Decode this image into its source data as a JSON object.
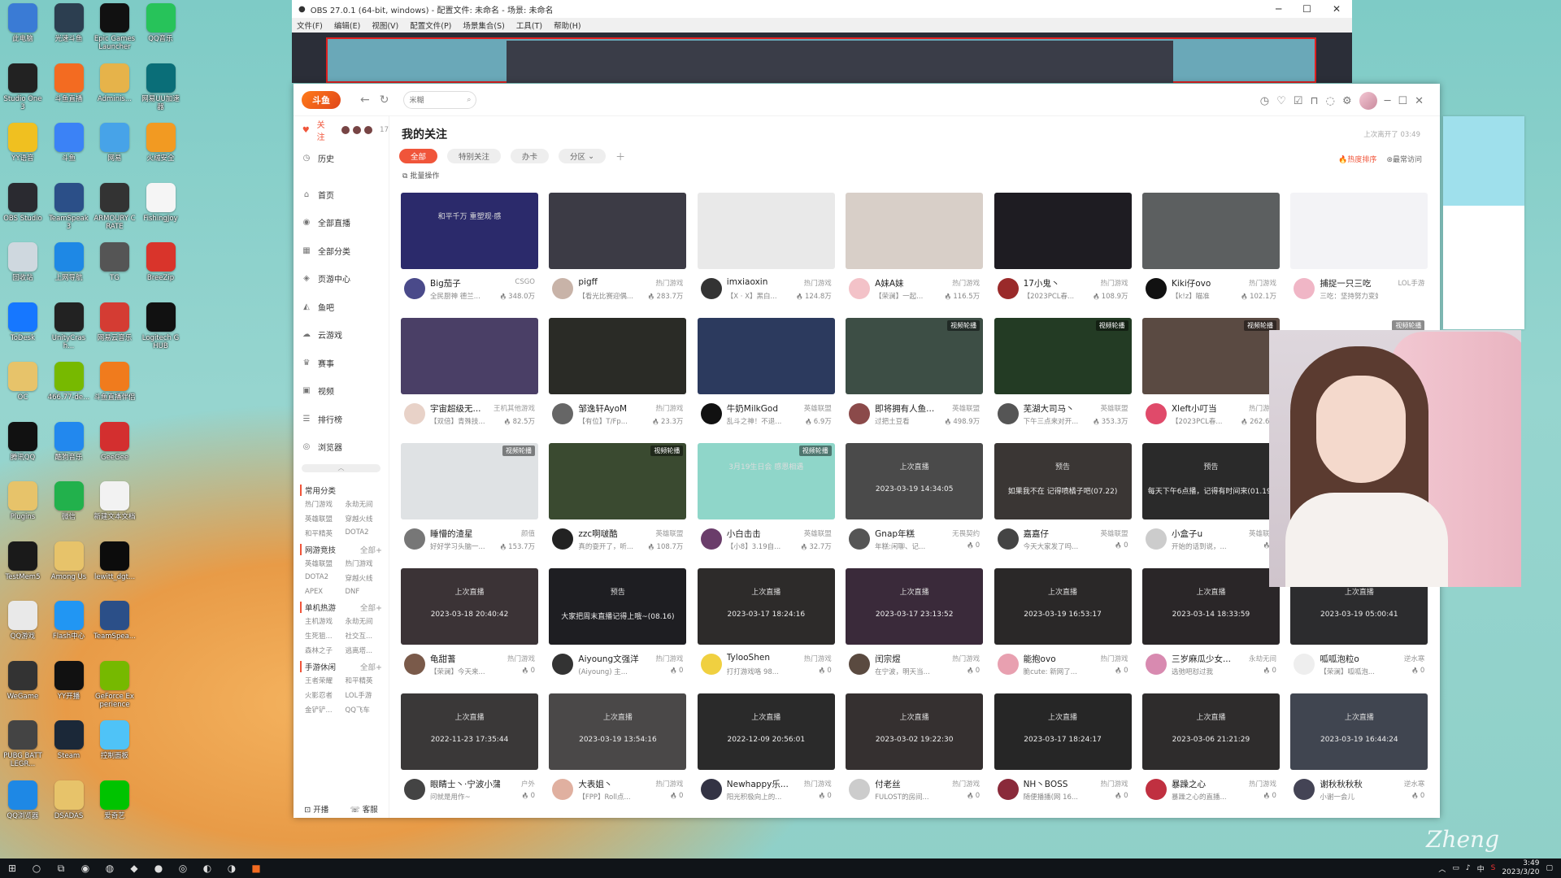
{
  "desktop": [
    {
      "label": "此电脑",
      "color": "#3a7bd5"
    },
    {
      "label": "光速斗鱼",
      "color": "#2c3e50"
    },
    {
      "label": "Epic Games Launcher",
      "color": "#111"
    },
    {
      "label": "QQ音乐",
      "color": "#27c35a"
    },
    {
      "label": "Studio One 3",
      "color": "#222"
    },
    {
      "label": "斗鱼直播",
      "color": "#f36b21"
    },
    {
      "label": "Adminis...",
      "color": "#e6b34a"
    },
    {
      "label": "网易UU加速器",
      "color": "#0a6e78"
    },
    {
      "label": "YY语音",
      "color": "#f0c020"
    },
    {
      "label": "斗鱼",
      "color": "#3b82f6"
    },
    {
      "label": "网易",
      "color": "#47a3e8"
    },
    {
      "label": "火绒安全",
      "color": "#f29a22"
    },
    {
      "label": "OBS Studio",
      "color": "#2a2a30"
    },
    {
      "label": "TeamSpeak 3",
      "color": "#2b4f88"
    },
    {
      "label": "ARMOURY CRATE",
      "color": "#333"
    },
    {
      "label": "FishingJoy",
      "color": "#f5f5f5"
    },
    {
      "label": "回收站",
      "color": "#cfd8df"
    },
    {
      "label": "上网导航",
      "color": "#1e88e5"
    },
    {
      "label": "TG",
      "color": "#555"
    },
    {
      "label": "BreeZip",
      "color": "#d9342b"
    },
    {
      "label": "ToDesk",
      "color": "#1677ff"
    },
    {
      "label": "UnityCrash...",
      "color": "#222"
    },
    {
      "label": "网易云音乐",
      "color": "#d43c33"
    },
    {
      "label": "Logitech G HUB",
      "color": "#111"
    },
    {
      "label": "OC",
      "color": "#e7c36a"
    },
    {
      "label": "466.77-de...",
      "color": "#77b900"
    },
    {
      "label": "斗鱼直播伴侣",
      "color": "#f07b1d"
    },
    {
      "label": "",
      "color": "transparent"
    },
    {
      "label": "腾讯QQ",
      "color": "#111"
    },
    {
      "label": "酷狗音乐",
      "color": "#2288ee"
    },
    {
      "label": "GeeGee",
      "color": "#d32f2f"
    },
    {
      "label": "",
      "color": "transparent"
    },
    {
      "label": "Plugins",
      "color": "#e7c36a"
    },
    {
      "label": "微信",
      "color": "#22b14c"
    },
    {
      "label": "新建文本文档",
      "color": "#f2f2f2"
    },
    {
      "label": "",
      "color": "transparent"
    },
    {
      "label": "TestMem5",
      "color": "#1a1a1a"
    },
    {
      "label": "Among Us",
      "color": "#e7c36a"
    },
    {
      "label": "lewitt_dgt...",
      "color": "#0c0c0c"
    },
    {
      "label": "",
      "color": "transparent"
    },
    {
      "label": "QQ游戏",
      "color": "#e9e9e9"
    },
    {
      "label": "Flash中心",
      "color": "#2196f3"
    },
    {
      "label": "TeamSpea...",
      "color": "#2b4f88"
    },
    {
      "label": "",
      "color": "transparent"
    },
    {
      "label": "WeGame",
      "color": "#333"
    },
    {
      "label": "YY开播",
      "color": "#111"
    },
    {
      "label": "GeForce Experience",
      "color": "#76b900"
    },
    {
      "label": "",
      "color": "transparent"
    },
    {
      "label": "PUBG BATTLEGR...",
      "color": "#444"
    },
    {
      "label": "Steam",
      "color": "#1b2838"
    },
    {
      "label": "控制面板",
      "color": "#4fc3f7"
    },
    {
      "label": "",
      "color": "transparent"
    },
    {
      "label": "QQ浏览器",
      "color": "#1e88e5"
    },
    {
      "label": "DSADAS",
      "color": "#e7c36a"
    },
    {
      "label": "爱奇艺",
      "color": "#00c300"
    },
    {
      "label": "",
      "color": "transparent"
    }
  ],
  "obs": {
    "title": "OBS 27.0.1 (64-bit, windows) - 配置文件: 未命名 - 场景: 未命名",
    "menu": [
      "文件(F)",
      "编辑(E)",
      "视图(V)",
      "配置文件(P)",
      "场景集合(S)",
      "工具(T)",
      "帮助(H)"
    ]
  },
  "app": {
    "logo": "斗鱼",
    "search_placeholder": "米糊",
    "side": {
      "follow": "关注",
      "follow_count": "17",
      "history": "历史",
      "items": [
        "首页",
        "全部直播",
        "全部分类",
        "页游中心",
        "鱼吧",
        "云游戏",
        "赛事",
        "视频",
        "排行榜",
        "浏览器"
      ],
      "sections": [
        {
          "title": "常用分类",
          "more": "",
          "items": [
            "热门游戏",
            "永劫无间",
            "英雄联盟",
            "穿越火线",
            "和平精英",
            "DOTA2"
          ]
        },
        {
          "title": "网游竞技",
          "more": "全部+",
          "items": [
            "英雄联盟",
            "热门游戏",
            "DOTA2",
            "穿越火线",
            "APEX",
            "DNF"
          ]
        },
        {
          "title": "单机热游",
          "more": "全部+",
          "items": [
            "主机游戏",
            "永劫无间",
            "生死狙...",
            "社交互...",
            "森林之子",
            "逃离塔..."
          ]
        },
        {
          "title": "手游休闲",
          "more": "全部+",
          "items": [
            "王者荣耀",
            "和平精英",
            "火影忍者",
            "LOL手游",
            "金铲铲...",
            "QQ飞车"
          ]
        }
      ],
      "bottom_left": "开播",
      "bottom_right": "客服"
    },
    "title": "我的关注",
    "last_visit": "上次离开了 03:49",
    "tabs": [
      "全部",
      "特别关注",
      "办卡",
      "分区"
    ],
    "sort_hot": "热度排序",
    "sort_recent": "最常访问",
    "batch": "批量操作",
    "cards": [
      {
        "name": "Big茄子",
        "cat": "CSGO",
        "desc": "全民厨神 德兰...",
        "heat": "348.0万",
        "thumb": "#2b2a6b",
        "tag": "",
        "ov": "和平千万 重塑观·感",
        "dt": "",
        "av": "#4a4a8a"
      },
      {
        "name": "pigff",
        "cat": "热门游戏",
        "desc": "【看光比赛迎偶...",
        "heat": "283.7万",
        "thumb": "#3c3b45",
        "tag": "",
        "ov": "",
        "dt": "",
        "av": "#c8b3a8"
      },
      {
        "name": "imxiaoxin",
        "cat": "热门游戏",
        "desc": "【X · X】黑白...",
        "heat": "124.8万",
        "thumb": "#e9e9e9",
        "tag": "",
        "ov": "",
        "dt": "",
        "av": "#333"
      },
      {
        "name": "A妹A妹",
        "cat": "热门游戏",
        "desc": "【荣澜】一起...",
        "heat": "116.5万",
        "thumb": "#d8cfc8",
        "tag": "",
        "ov": "",
        "dt": "",
        "av": "#f3c2c8"
      },
      {
        "name": "17小鬼丶",
        "cat": "热门游戏",
        "desc": "【2023PCL春...",
        "heat": "108.9万",
        "thumb": "#1e1c22",
        "tag": "",
        "ov": "",
        "dt": "",
        "av": "#9a2a2a"
      },
      {
        "name": "Kiki仔ovo",
        "cat": "热门游戏",
        "desc": "【k!z】瞄准",
        "heat": "102.1万",
        "thumb": "#5c5f60",
        "tag": "",
        "ov": "",
        "dt": "",
        "av": "#111"
      },
      {
        "name": "捕捉一只三吃",
        "cat": "LOL手游",
        "desc": "三吃：坚持努力变好！",
        "heat": "",
        "thumb": "#f3f3f6",
        "tag": "",
        "ov": "",
        "dt": "",
        "av": "#f0b6c6"
      },
      {
        "name": "宇宙超级无...",
        "cat": "王机其他游戏",
        "desc": "【双倍】青殊技...",
        "heat": "82.5万",
        "thumb": "#4a3f66",
        "tag": "",
        "ov": "",
        "dt": "",
        "av": "#e8d2c8"
      },
      {
        "name": "邹逸轩AyoM",
        "cat": "热门游戏",
        "desc": "【有位】T/Fp...",
        "heat": "23.3万",
        "thumb": "#2a2b26",
        "tag": "",
        "ov": "",
        "dt": "",
        "av": "#666"
      },
      {
        "name": "牛奶MilkGod",
        "cat": "英雄联盟",
        "desc": "乱斗之神！不退...",
        "heat": "6.9万",
        "thumb": "#2c3a5e",
        "tag": "",
        "ov": "",
        "dt": "",
        "av": "#111"
      },
      {
        "name": "即将拥有人鱼...",
        "cat": "英雄联盟",
        "desc": "过把土豆看",
        "heat": "498.9万",
        "thumb": "#3d4e45",
        "tag": "视频轮播",
        "ov": "",
        "dt": "",
        "av": "#8b4a4a"
      },
      {
        "name": "芜湖大司马丶",
        "cat": "英雄联盟",
        "desc": "下午三点来对开...",
        "heat": "353.3万",
        "thumb": "#233b24",
        "tag": "视频轮播",
        "ov": "",
        "dt": "",
        "av": "#555"
      },
      {
        "name": "Xleft小叮当",
        "cat": "热门游戏",
        "desc": "【2023PCL春...",
        "heat": "262.6万",
        "thumb": "#5a4a42",
        "tag": "视频轮播",
        "ov": "",
        "dt": "",
        "av": "#e04a6a"
      },
      {
        "name": "",
        "cat": "",
        "desc": "",
        "heat": "",
        "thumb": "#fff",
        "tag": "视频轮播",
        "ov": "",
        "dt": "",
        "av": "#fff"
      },
      {
        "name": "睡懵的渣星",
        "cat": "颜值",
        "desc": "好好学习头脑一...",
        "heat": "153.7万",
        "thumb": "#dfe2e4",
        "tag": "视频轮播",
        "ov": "",
        "dt": "",
        "av": "#777"
      },
      {
        "name": "zzc啊啵酷",
        "cat": "英雄联盟",
        "desc": "真的耍开了，听...",
        "heat": "108.7万",
        "thumb": "#3a4a30",
        "tag": "视频轮播",
        "ov": "",
        "dt": "",
        "av": "#222"
      },
      {
        "name": "小白击击",
        "cat": "英雄联盟",
        "desc": "【小8】3.19自...",
        "heat": "32.7万",
        "thumb": "#8fd6c9",
        "tag": "视频轮播",
        "ov": "3月19生日会 感恩相遇",
        "dt": "",
        "av": "#6a3d6a"
      },
      {
        "name": "Gnap年糕",
        "cat": "无畏契约",
        "desc": "年糕:闲聊、记...",
        "heat": "0",
        "thumb": "#4a4a4a",
        "tag": "",
        "ov": "上次直播",
        "dt": "2023-03-19 14:34:05",
        "av": "#555"
      },
      {
        "name": "嘉嘉仔",
        "cat": "英雄联盟",
        "desc": "今天大家发了吗...",
        "heat": "0",
        "thumb": "#3a3634",
        "tag": "",
        "ov": "预告",
        "dt": "如果我不在 记得喷橘子吧(07.22)",
        "av": "#444"
      },
      {
        "name": "小盒子u",
        "cat": "英雄联盟",
        "desc": "开始的话到说，...",
        "heat": "0",
        "thumb": "#2a2a2a",
        "tag": "",
        "ov": "预告",
        "dt": "每天下午6点播，记得有时间来(01.19)",
        "av": "#ccc"
      },
      {
        "name": "",
        "cat": "",
        "desc": "",
        "heat": "",
        "thumb": "#fff",
        "tag": "",
        "ov": "",
        "dt": "",
        "av": "#fff"
      },
      {
        "name": "龟甜蓍",
        "cat": "热门游戏",
        "desc": "【荣澜】今天来...",
        "heat": "0",
        "thumb": "#3b3336",
        "tag": "",
        "ov": "上次直播",
        "dt": "2023-03-18 20:40:42",
        "av": "#7a5a4a"
      },
      {
        "name": "Aiyoung文强洋",
        "cat": "热门游戏",
        "desc": "(Aiyoung) 主...",
        "heat": "0",
        "thumb": "#1e1e22",
        "tag": "",
        "ov": "预告",
        "dt": "大家把周末直播记得上哦~(08.16)",
        "av": "#333"
      },
      {
        "name": "TylooShen",
        "cat": "热门游戏",
        "desc": "打打游戏咯 98...",
        "heat": "0",
        "thumb": "#2d2b2a",
        "tag": "",
        "ov": "上次直播",
        "dt": "2023-03-17 18:24:16",
        "av": "#f0d040"
      },
      {
        "name": "闰宗煜",
        "cat": "热门游戏",
        "desc": "在宁波，明天当...",
        "heat": "0",
        "thumb": "#3a2a3a",
        "tag": "",
        "ov": "上次直播",
        "dt": "2023-03-17 23:13:52",
        "av": "#5a4a40"
      },
      {
        "name": "能抱ovo",
        "cat": "热门游戏",
        "desc": "脆cute: 新网了...",
        "heat": "0",
        "thumb": "#2a2828",
        "tag": "",
        "ov": "上次直播",
        "dt": "2023-03-19 16:53:17",
        "av": "#e8a0b0"
      },
      {
        "name": "三岁麻瓜少女...",
        "cat": "永劫无间",
        "desc": "选弛吧怼过我",
        "heat": "0",
        "thumb": "#2a2628",
        "tag": "",
        "ov": "上次直播",
        "dt": "2023-03-14 18:33:59",
        "av": "#d88ab0"
      },
      {
        "name": "呱呱泡粒o",
        "cat": "逆水寒",
        "desc": "【荣澜】呱呱泡...",
        "heat": "0",
        "thumb": "#2c2c2e",
        "tag": "",
        "ov": "上次直播",
        "dt": "2023-03-19 05:00:41",
        "av": "#eee"
      },
      {
        "name": "眼睛士丶·宁波小蒲藤",
        "cat": "户外",
        "desc": "问就是用作~",
        "heat": "0",
        "thumb": "#3a3838",
        "tag": "",
        "ov": "上次直播",
        "dt": "2022-11-23 17:35:44",
        "av": "#444"
      },
      {
        "name": "大表姐丶",
        "cat": "热门游戏",
        "desc": "【FPP】Roll点...",
        "heat": "0",
        "thumb": "#4a4848",
        "tag": "",
        "ov": "上次直播",
        "dt": "2023-03-19 13:54:16",
        "av": "#e0b0a0"
      },
      {
        "name": "Newhappy乐...",
        "cat": "热门游戏",
        "desc": "阳光积极向上的...",
        "heat": "0",
        "thumb": "#2a2a2a",
        "tag": "",
        "ov": "上次直播",
        "dt": "2022-12-09 20:56:01",
        "av": "#334"
      },
      {
        "name": "付老丝",
        "cat": "热门游戏",
        "desc": "FULOST的房间...",
        "heat": "0",
        "thumb": "#353030",
        "tag": "",
        "ov": "上次直播",
        "dt": "2023-03-02 19:22:30",
        "av": "#ccc"
      },
      {
        "name": "NH丶BOSS",
        "cat": "热门游戏",
        "desc": "随便播播(网 16...",
        "heat": "0",
        "thumb": "#262626",
        "tag": "",
        "ov": "上次直播",
        "dt": "2023-03-17 18:24:17",
        "av": "#8a2a3a"
      },
      {
        "name": "暴躁之心",
        "cat": "热门游戏",
        "desc": "暴躁之心的直播...",
        "heat": "0",
        "thumb": "#2e2c2c",
        "tag": "",
        "ov": "上次直播",
        "dt": "2023-03-06 21:21:29",
        "av": "#c03040"
      },
      {
        "name": "谢秋秋秋秋",
        "cat": "逆水寒",
        "desc": "小谢一会儿",
        "heat": "0",
        "thumb": "#404550",
        "tag": "",
        "ov": "上次直播",
        "dt": "2023-03-19 16:44:24",
        "av": "#445"
      }
    ]
  },
  "taskbar": {
    "time": "3:49",
    "date": "2023/3/20",
    "ime": "中"
  },
  "signature": "Zheng"
}
